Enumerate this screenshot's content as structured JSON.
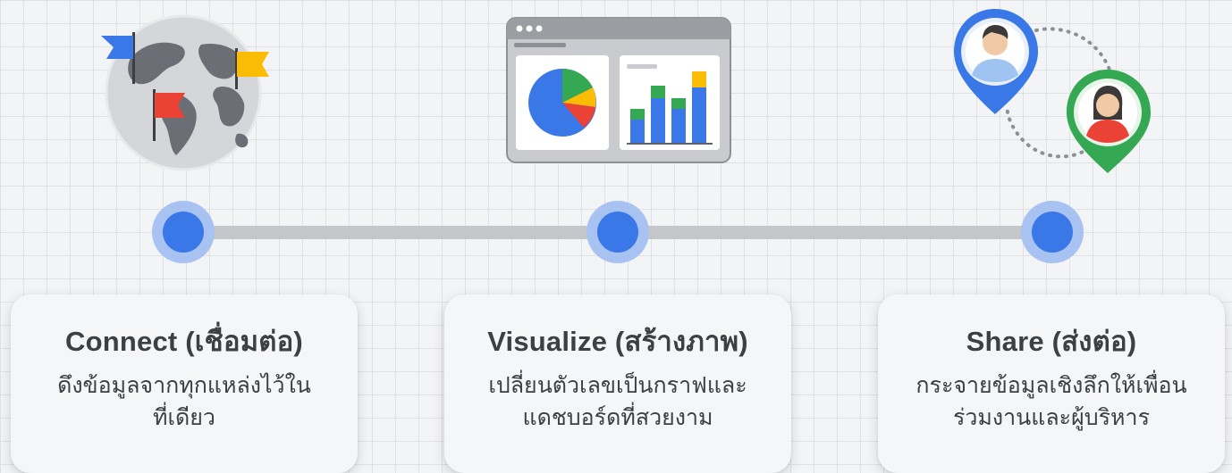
{
  "steps": [
    {
      "title": "Connect (เชื่อมต่อ)",
      "desc_line1": "ดึงข้อมูลจากทุกแหล่งไว้ใน",
      "desc_line2": "ที่เดียว",
      "icon": "globe-with-flags-icon"
    },
    {
      "title": "Visualize (สร้างภาพ)",
      "desc_line1": "เปลี่ยนตัวเลขเป็นกราฟและ",
      "desc_line2": "แดชบอร์ดที่สวยงาม",
      "icon": "dashboard-charts-icon"
    },
    {
      "title": "Share (ส่งต่อ)",
      "desc_line1": "กระจายข้อมูลเชิงลึกให้เพื่อน",
      "desc_line2": "ร่วมงานและผู้บริหาร",
      "icon": "shared-location-pins-icon"
    }
  ],
  "colors": {
    "blue": "#3b78e7",
    "red": "#ea4335",
    "yellow": "#fbbc04",
    "green": "#34a853",
    "node_ring": "#a8c2f2",
    "bar": "#c4c6ca"
  }
}
